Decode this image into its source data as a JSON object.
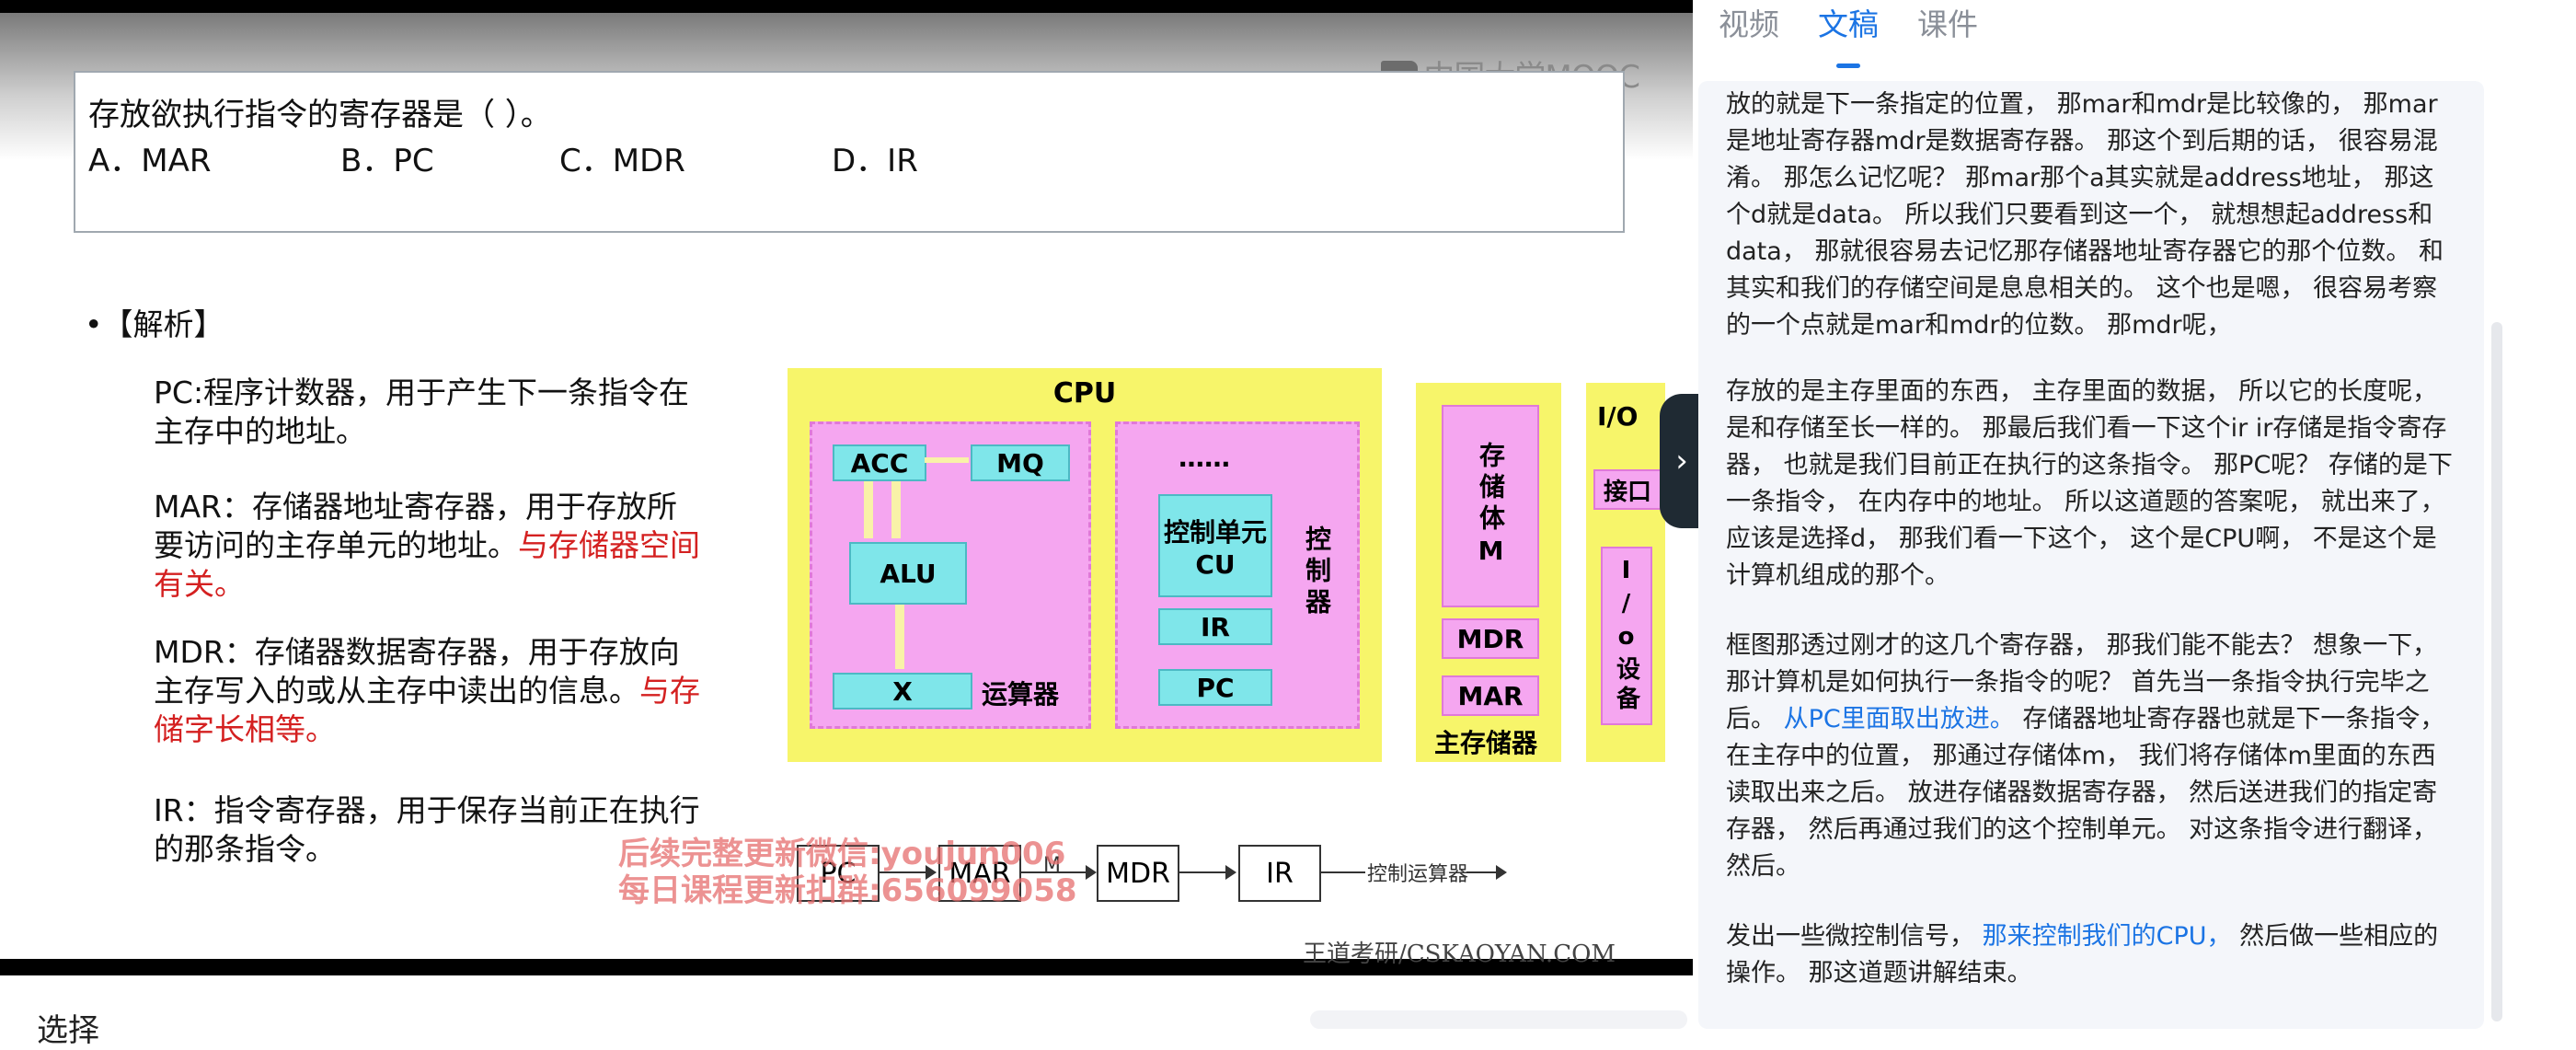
{
  "video": {
    "logo": "中国大学MOOC",
    "question": "存放欲执行指令的寄存器是（    ）。",
    "options": [
      "A．MAR",
      "B．PC",
      "C．MDR",
      "D．IR"
    ],
    "analysis_title": "•【解析】",
    "definitions": {
      "pc": "PC:程序计数器，用于产生下一条指令在主存中的地址。",
      "mar": "MAR：存储器地址寄存器，用于存放所要访问的主存单元的地址。",
      "mar_red": "与存储器空间有关。",
      "mdr": "MDR：存储器数据寄存器，用于存放向主存写入的或从主存中读出的信息。",
      "mdr_red": "与存储字长相等。",
      "ir": "IR：指令寄存器，用于保存当前正在执行的那条指令。"
    },
    "diagram": {
      "cpu": "CPU",
      "acc": "ACC",
      "mq": "MQ",
      "alu": "ALU",
      "x": "X",
      "alu_unit": "运算器",
      "dots": "……",
      "cu": "控制单元CU",
      "ir": "IR",
      "pc": "PC",
      "controller": "控制器",
      "storage_body": "存储体M",
      "mdr": "MDR",
      "mar": "MAR",
      "main_memory": "主存储器",
      "io": "I/O",
      "interface": "接口",
      "io_device": "I/o设备"
    },
    "flow": {
      "pc": "PC",
      "mar": "MAR",
      "m": "M",
      "mdr": "MDR",
      "ir": "IR",
      "end": "控制运算器"
    },
    "watermark_1": "后续完整更新微信:youjun006",
    "watermark_2": "每日课程更新扣群:656099058",
    "credit": "王道考研/CSKAOYAN.COM",
    "expand_icon": "›"
  },
  "below_video": {
    "title": "选择"
  },
  "tabs": [
    "视频",
    "文稿",
    "课件"
  ],
  "transcript": {
    "p1": "放的就是下一条指定的位置， 那mar和mdr是比较像的， 那mar是地址寄存器mdr是数据寄存器。 那这个到后期的话， 很容易混淆。 那怎么记忆呢？ 那mar那个a其实就是address地址， 那这个d就是data。 所以我们只要看到这一个， 就想想起address和data， 那就很容易去记忆那存储器地址寄存器它的那个位数。 和其实和我们的存储空间是息息相关的。 这个也是嗯， 很容易考察的一个点就是mar和mdr的位数。 那mdr呢，",
    "p2": "存放的是主存里面的东西， 主存里面的数据， 所以它的长度呢， 是和存储至长一样的。 那最后我们看一下这个ir ir存储是指令寄存器， 也就是我们目前正在执行的这条指令。 那PC呢？ 存储的是下一条指令， 在内存中的地址。 所以这道题的答案呢， 就出来了， 应该是选择d， 那我们看一下这个， 这个是CPU啊， 不是这个是计算机组成的那个。",
    "p3a": "框图那透过刚才的这几个寄存器， 那我们能不能去？ 想象一下， 那计算机是如何执行一条指令的呢？ 首先当一条指令执行完毕之后。 ",
    "p3_blue": "从PC里面取出放进。",
    "p3b": " 存储器地址寄存器也就是下一条指令， 在主存中的位置， 那通过存储体m， 我们将存储体m里面的东西读取出来之后。 放进存储器数据寄存器， 然后送进我们的指定寄存器， 然后再通过我们的这个控制单元。 对这条指令进行翻译， 然后。",
    "p4a": "发出一些微控制信号， ",
    "p4_blue": "那来控制我们的CPU，",
    "p4b": " 然后做一些相应的操作。 那这道题讲解结束。"
  }
}
